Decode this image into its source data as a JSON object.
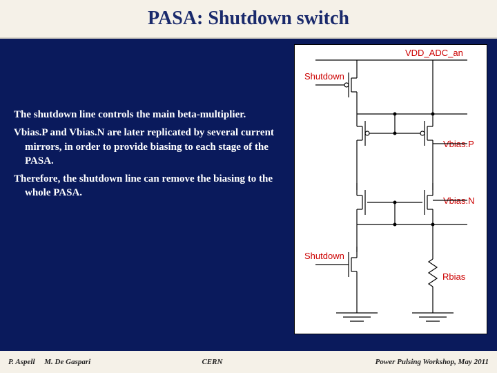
{
  "title": "PASA: Shutdown switch",
  "body": {
    "p1": "The shutdown line controls the main beta-multiplier.",
    "p2": "Vbias.P and Vbias.N are later replicated by several current mirrors, in order to provide biasing to each stage of the PASA.",
    "p3": "Therefore, the shutdown line can remove the biasing to the whole PASA."
  },
  "labels": {
    "vdd": "VDD_ADC_an",
    "shutdown1": "Shutdown",
    "vbiasp": "Vbias.P",
    "vbiasn": "Vbias.N",
    "shutdown2": "Shutdown",
    "rbias": "Rbias"
  },
  "footer": {
    "author1": "P. Aspell",
    "author2": "M. De Gaspari",
    "org": "CERN",
    "event": "Power Pulsing Workshop, May 2011"
  }
}
